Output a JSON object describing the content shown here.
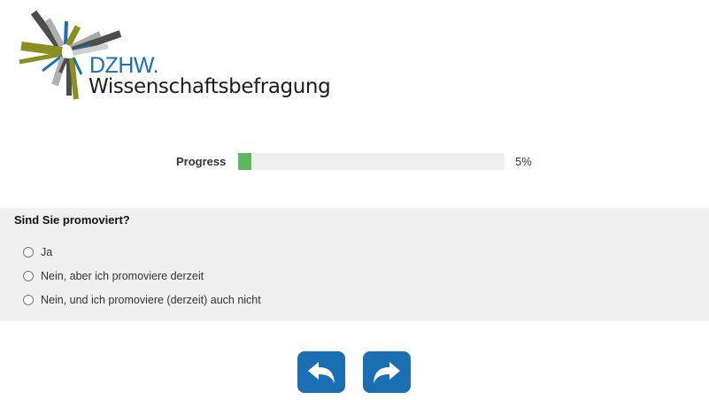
{
  "logo": {
    "brand": "DZHW.",
    "subtitle": "Wissenschaftsbefragung"
  },
  "progress": {
    "label": "Progress",
    "value_text": "5%",
    "fraction": 0.05,
    "color": "#5cb85c"
  },
  "question": {
    "text": "Sind Sie promoviert?",
    "options": [
      "Ja",
      "Nein, aber ich promoviere derzeit",
      "Nein, und ich promoviere (derzeit) auch nicht"
    ]
  },
  "nav": {
    "back_icon": "back-arrow-icon",
    "next_icon": "forward-arrow-icon",
    "button_color": "#1a6fb3"
  }
}
